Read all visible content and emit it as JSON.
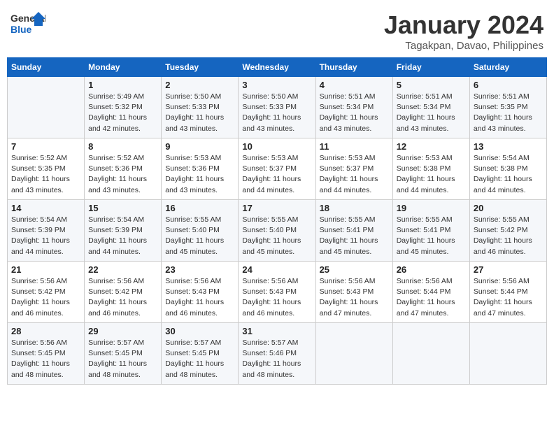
{
  "logo": {
    "line1": "General",
    "line2": "Blue"
  },
  "title": "January 2024",
  "location": "Tagakpan, Davao, Philippines",
  "days_of_week": [
    "Sunday",
    "Monday",
    "Tuesday",
    "Wednesday",
    "Thursday",
    "Friday",
    "Saturday"
  ],
  "weeks": [
    [
      {
        "day": null,
        "info": null
      },
      {
        "day": "1",
        "info": "Sunrise: 5:49 AM\nSunset: 5:32 PM\nDaylight: 11 hours\nand 42 minutes."
      },
      {
        "day": "2",
        "info": "Sunrise: 5:50 AM\nSunset: 5:33 PM\nDaylight: 11 hours\nand 43 minutes."
      },
      {
        "day": "3",
        "info": "Sunrise: 5:50 AM\nSunset: 5:33 PM\nDaylight: 11 hours\nand 43 minutes."
      },
      {
        "day": "4",
        "info": "Sunrise: 5:51 AM\nSunset: 5:34 PM\nDaylight: 11 hours\nand 43 minutes."
      },
      {
        "day": "5",
        "info": "Sunrise: 5:51 AM\nSunset: 5:34 PM\nDaylight: 11 hours\nand 43 minutes."
      },
      {
        "day": "6",
        "info": "Sunrise: 5:51 AM\nSunset: 5:35 PM\nDaylight: 11 hours\nand 43 minutes."
      }
    ],
    [
      {
        "day": "7",
        "info": "Sunrise: 5:52 AM\nSunset: 5:35 PM\nDaylight: 11 hours\nand 43 minutes."
      },
      {
        "day": "8",
        "info": "Sunrise: 5:52 AM\nSunset: 5:36 PM\nDaylight: 11 hours\nand 43 minutes."
      },
      {
        "day": "9",
        "info": "Sunrise: 5:53 AM\nSunset: 5:36 PM\nDaylight: 11 hours\nand 43 minutes."
      },
      {
        "day": "10",
        "info": "Sunrise: 5:53 AM\nSunset: 5:37 PM\nDaylight: 11 hours\nand 44 minutes."
      },
      {
        "day": "11",
        "info": "Sunrise: 5:53 AM\nSunset: 5:37 PM\nDaylight: 11 hours\nand 44 minutes."
      },
      {
        "day": "12",
        "info": "Sunrise: 5:53 AM\nSunset: 5:38 PM\nDaylight: 11 hours\nand 44 minutes."
      },
      {
        "day": "13",
        "info": "Sunrise: 5:54 AM\nSunset: 5:38 PM\nDaylight: 11 hours\nand 44 minutes."
      }
    ],
    [
      {
        "day": "14",
        "info": "Sunrise: 5:54 AM\nSunset: 5:39 PM\nDaylight: 11 hours\nand 44 minutes."
      },
      {
        "day": "15",
        "info": "Sunrise: 5:54 AM\nSunset: 5:39 PM\nDaylight: 11 hours\nand 44 minutes."
      },
      {
        "day": "16",
        "info": "Sunrise: 5:55 AM\nSunset: 5:40 PM\nDaylight: 11 hours\nand 45 minutes."
      },
      {
        "day": "17",
        "info": "Sunrise: 5:55 AM\nSunset: 5:40 PM\nDaylight: 11 hours\nand 45 minutes."
      },
      {
        "day": "18",
        "info": "Sunrise: 5:55 AM\nSunset: 5:41 PM\nDaylight: 11 hours\nand 45 minutes."
      },
      {
        "day": "19",
        "info": "Sunrise: 5:55 AM\nSunset: 5:41 PM\nDaylight: 11 hours\nand 45 minutes."
      },
      {
        "day": "20",
        "info": "Sunrise: 5:55 AM\nSunset: 5:42 PM\nDaylight: 11 hours\nand 46 minutes."
      }
    ],
    [
      {
        "day": "21",
        "info": "Sunrise: 5:56 AM\nSunset: 5:42 PM\nDaylight: 11 hours\nand 46 minutes."
      },
      {
        "day": "22",
        "info": "Sunrise: 5:56 AM\nSunset: 5:42 PM\nDaylight: 11 hours\nand 46 minutes."
      },
      {
        "day": "23",
        "info": "Sunrise: 5:56 AM\nSunset: 5:43 PM\nDaylight: 11 hours\nand 46 minutes."
      },
      {
        "day": "24",
        "info": "Sunrise: 5:56 AM\nSunset: 5:43 PM\nDaylight: 11 hours\nand 46 minutes."
      },
      {
        "day": "25",
        "info": "Sunrise: 5:56 AM\nSunset: 5:43 PM\nDaylight: 11 hours\nand 47 minutes."
      },
      {
        "day": "26",
        "info": "Sunrise: 5:56 AM\nSunset: 5:44 PM\nDaylight: 11 hours\nand 47 minutes."
      },
      {
        "day": "27",
        "info": "Sunrise: 5:56 AM\nSunset: 5:44 PM\nDaylight: 11 hours\nand 47 minutes."
      }
    ],
    [
      {
        "day": "28",
        "info": "Sunrise: 5:56 AM\nSunset: 5:45 PM\nDaylight: 11 hours\nand 48 minutes."
      },
      {
        "day": "29",
        "info": "Sunrise: 5:57 AM\nSunset: 5:45 PM\nDaylight: 11 hours\nand 48 minutes."
      },
      {
        "day": "30",
        "info": "Sunrise: 5:57 AM\nSunset: 5:45 PM\nDaylight: 11 hours\nand 48 minutes."
      },
      {
        "day": "31",
        "info": "Sunrise: 5:57 AM\nSunset: 5:46 PM\nDaylight: 11 hours\nand 48 minutes."
      },
      {
        "day": null,
        "info": null
      },
      {
        "day": null,
        "info": null
      },
      {
        "day": null,
        "info": null
      }
    ]
  ]
}
